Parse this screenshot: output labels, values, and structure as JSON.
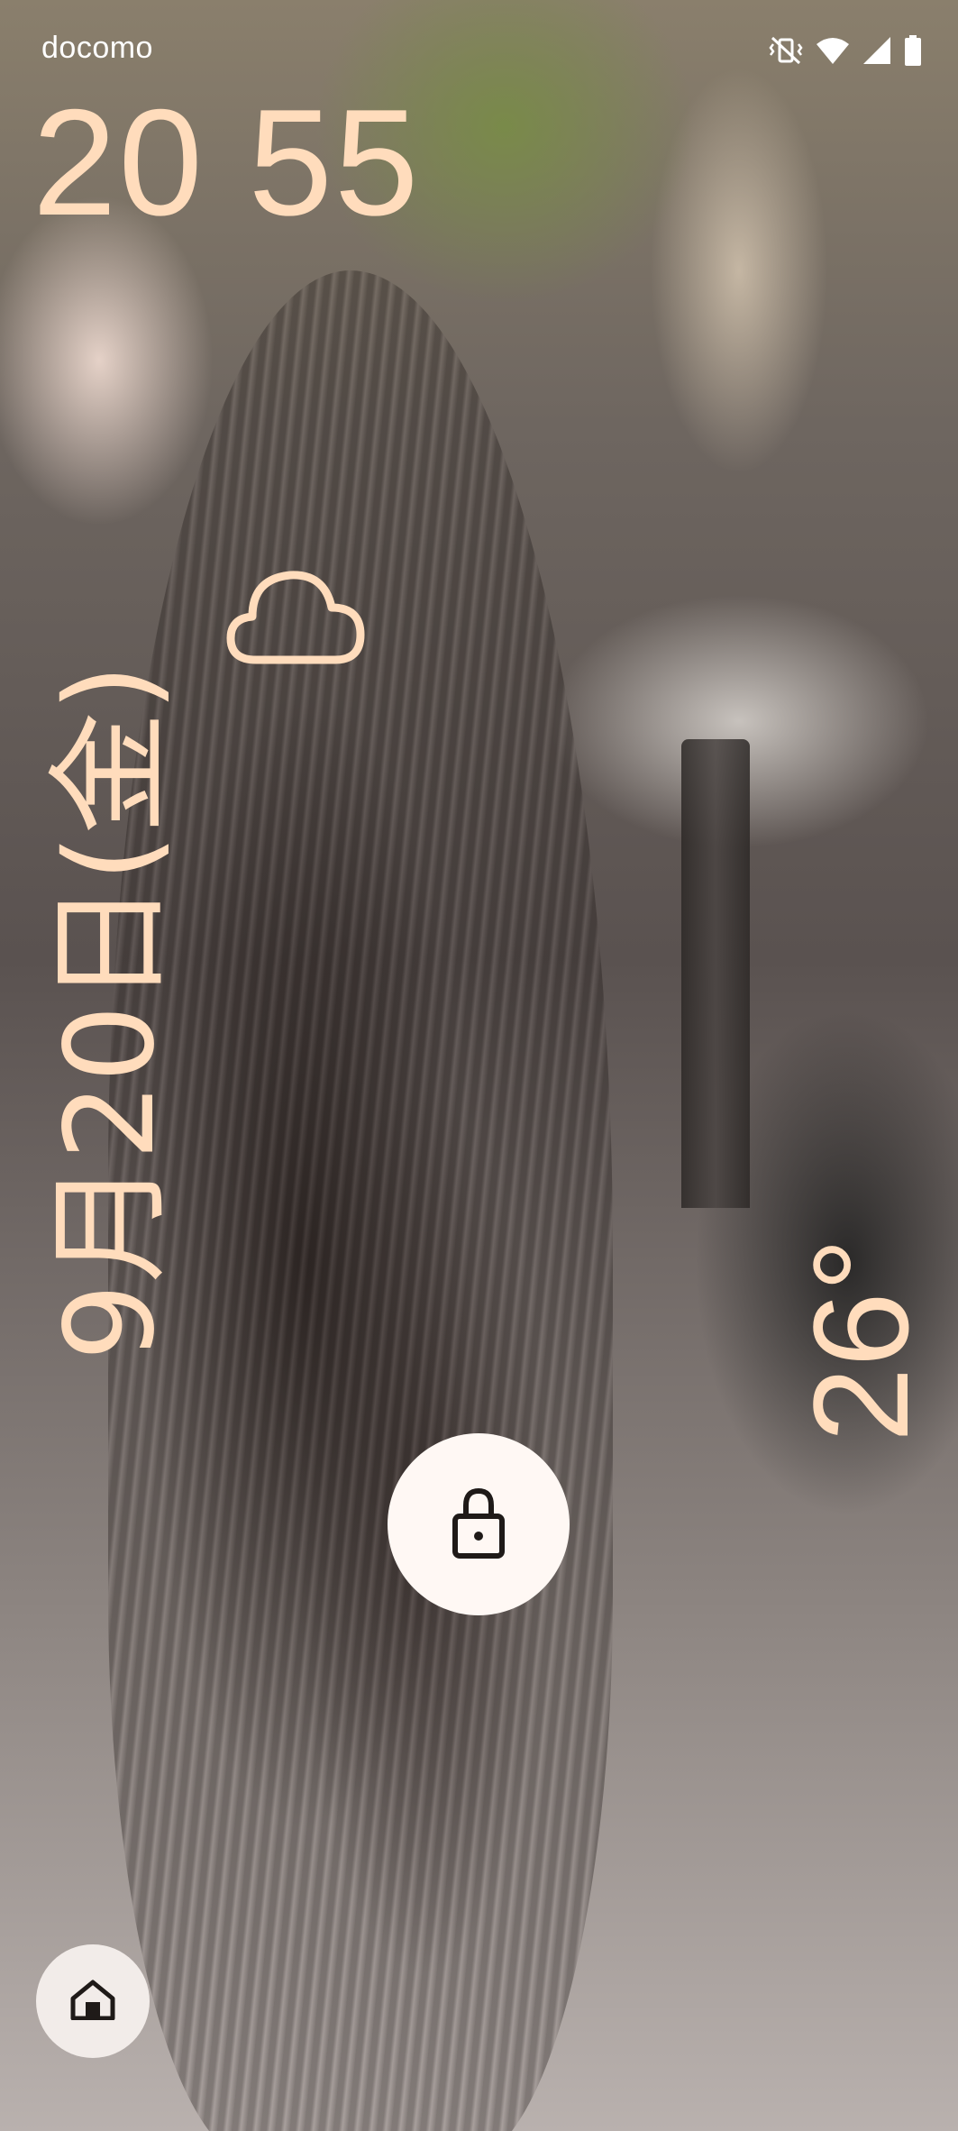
{
  "status_bar": {
    "carrier": "docomo",
    "icons": [
      "vibrate-off-icon",
      "wifi-icon",
      "cellular-signal-icon",
      "battery-icon"
    ]
  },
  "lockscreen": {
    "time": "20 55",
    "date": "9月20日(金)",
    "weather": {
      "icon": "cloud-icon",
      "temperature": "26°"
    },
    "lock_icon": "lock-icon",
    "shortcut_icon": "home-icon"
  },
  "colors": {
    "clock_text": "#ffdcbc",
    "button_bg": "#fff8f4",
    "icon_stroke": "#1f1a18"
  }
}
